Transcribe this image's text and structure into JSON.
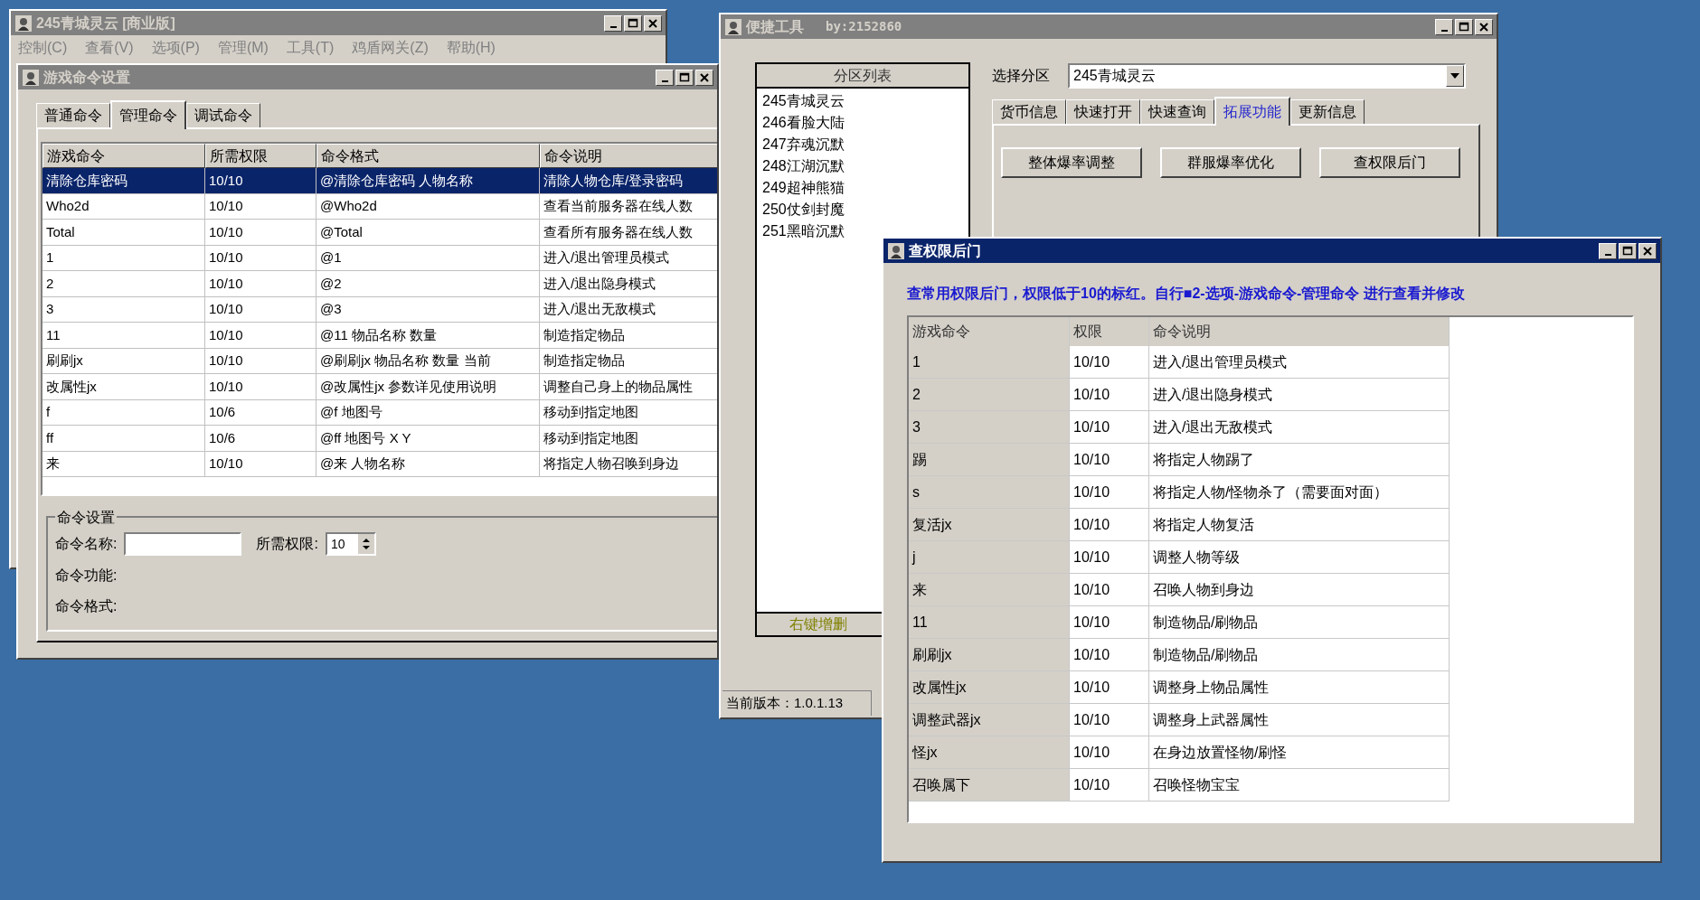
{
  "main_window": {
    "title": "245青城灵云 [商业版]",
    "active": false,
    "menu": [
      "控制(C)",
      "查看(V)",
      "选项(P)",
      "管理(M)",
      "工具(T)",
      "鸡盾网关(Z)",
      "帮助(H)"
    ]
  },
  "command_settings_window": {
    "title": "游戏命令设置",
    "active": false,
    "tabs": [
      {
        "label": "普通命令",
        "selected": false
      },
      {
        "label": "管理命令",
        "selected": true
      },
      {
        "label": "调试命令",
        "selected": false
      }
    ],
    "table": {
      "columns": [
        "游戏命令",
        "所需权限",
        "命令格式",
        "命令说明"
      ],
      "rows": [
        {
          "cells": [
            "清除仓库密码",
            "10/10",
            "@清除仓库密码 人物名称",
            "清除人物仓库/登录密码"
          ],
          "selected": true
        },
        {
          "cells": [
            "Who2d",
            "10/10",
            "@Who2d",
            "查看当前服务器在线人数"
          ],
          "selected": false
        },
        {
          "cells": [
            "Total",
            "10/10",
            "@Total",
            "查看所有服务器在线人数"
          ],
          "selected": false
        },
        {
          "cells": [
            "1",
            "10/10",
            "@1",
            "进入/退出管理员模式"
          ],
          "selected": false
        },
        {
          "cells": [
            "2",
            "10/10",
            "@2",
            "进入/退出隐身模式"
          ],
          "selected": false
        },
        {
          "cells": [
            "3",
            "10/10",
            "@3",
            "进入/退出无敌模式"
          ],
          "selected": false
        },
        {
          "cells": [
            "11",
            "10/10",
            "@11 物品名称 数量",
            "制造指定物品"
          ],
          "selected": false
        },
        {
          "cells": [
            "刷刷jx",
            "10/10",
            "@刷刷jx 物品名称 数量 当前",
            "制造指定物品"
          ],
          "selected": false
        },
        {
          "cells": [
            "改属性jx",
            "10/10",
            "@改属性jx 参数详见使用说明",
            "调整自己身上的物品属性"
          ],
          "selected": false
        },
        {
          "cells": [
            "f",
            "10/6",
            "@f 地图号",
            "移动到指定地图"
          ],
          "selected": false
        },
        {
          "cells": [
            "ff",
            "10/6",
            "@ff 地图号 X Y",
            "移动到指定地图"
          ],
          "selected": false
        },
        {
          "cells": [
            "来",
            "10/10",
            "@来 人物名称",
            "将指定人物召唤到身边"
          ],
          "selected": false
        }
      ]
    },
    "group": {
      "title": "命令设置",
      "name_label": "命令名称:",
      "permission_label": "所需权限:",
      "permission_value": "10",
      "function_label": "命令功能:",
      "format_label": "命令格式:"
    }
  },
  "tool_window": {
    "title": "便捷工具",
    "author": "by:2152860",
    "active": false,
    "partition_list": {
      "header": "分区列表",
      "items": [
        "245青城灵云",
        "246看脸大陆",
        "247弃魂沉默",
        "248江湖沉默",
        "249超神熊猫",
        "250仗剑封魔",
        "251黑暗沉默"
      ],
      "footer": "右键增删"
    },
    "select_label": "选择分区",
    "select_value": "245青城灵云",
    "tabs": [
      {
        "label": "货币信息",
        "selected": false
      },
      {
        "label": "快速打开",
        "selected": false
      },
      {
        "label": "快速查询",
        "selected": false
      },
      {
        "label": "拓展功能",
        "selected": true
      },
      {
        "label": "更新信息",
        "selected": false
      }
    ],
    "buttons": [
      "整体爆率调整",
      "群服爆率优化",
      "查权限后门"
    ],
    "version": "当前版本：1.0.1.13"
  },
  "backdoor_dialog": {
    "title": "查权限后门",
    "active": true,
    "notice": "查常用权限后门，权限低于10的标红。自行■2-选项-游戏命令-管理命令 进行查看并修改",
    "table": {
      "columns": [
        "游戏命令",
        "权限",
        "命令说明"
      ],
      "rows": [
        [
          "1",
          "10/10",
          "进入/退出管理员模式"
        ],
        [
          "2",
          "10/10",
          "进入/退出隐身模式"
        ],
        [
          "3",
          "10/10",
          "进入/退出无敌模式"
        ],
        [
          "踢",
          "10/10",
          "将指定人物踢了"
        ],
        [
          "s",
          "10/10",
          "将指定人物/怪物杀了（需要面对面）"
        ],
        [
          "复活jx",
          "10/10",
          "将指定人物复活"
        ],
        [
          "j",
          "10/10",
          "调整人物等级"
        ],
        [
          "来",
          "10/10",
          "召唤人物到身边"
        ],
        [
          "11",
          "10/10",
          "制造物品/刷物品"
        ],
        [
          "刷刷jx",
          "10/10",
          "制造物品/刷物品"
        ],
        [
          "改属性jx",
          "10/10",
          "调整身上物品属性"
        ],
        [
          "调整武器jx",
          "10/10",
          "调整身上武器属性"
        ],
        [
          "怪jx",
          "10/10",
          "在身边放置怪物/刷怪"
        ],
        [
          "召唤属下",
          "10/10",
          "召唤怪物宝宝"
        ]
      ]
    }
  }
}
